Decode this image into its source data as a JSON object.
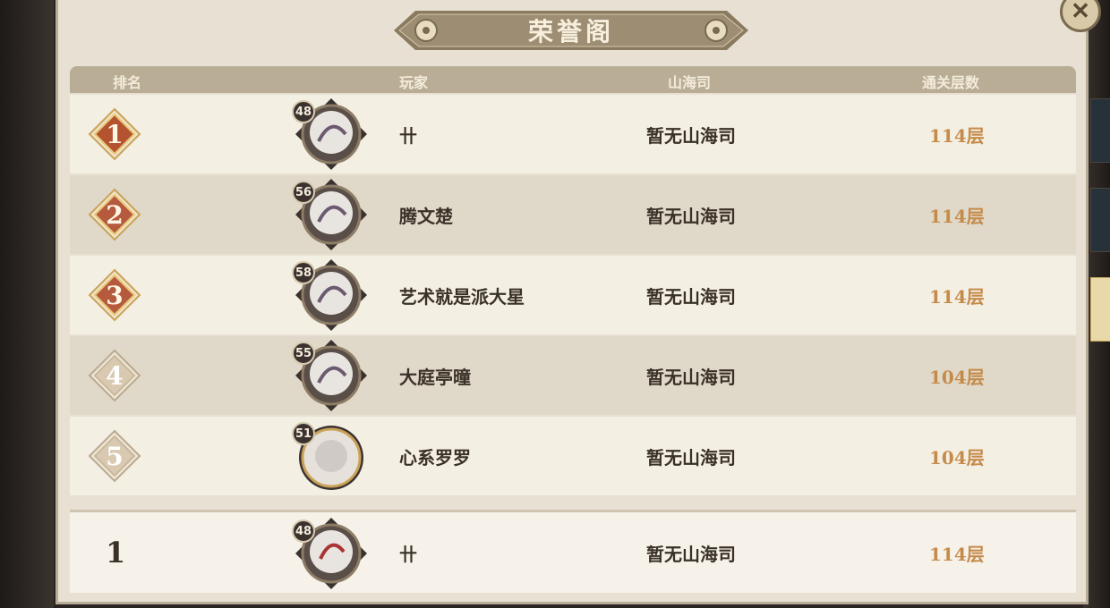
{
  "window": {
    "title": "荣誉阁",
    "close_icon": "close-icon"
  },
  "table": {
    "columns": [
      "排名",
      "玩家",
      "山海司",
      "通关层数"
    ],
    "rows": [
      {
        "rank": "1",
        "level": "48",
        "name": "卄",
        "guild": "暂无山海司",
        "floor": "114层",
        "rank_color": "#b4532f"
      },
      {
        "rank": "2",
        "level": "56",
        "name": "腾文楚",
        "guild": "暂无山海司",
        "floor": "114层",
        "rank_color": "#b65a3e"
      },
      {
        "rank": "3",
        "level": "58",
        "name": "艺术就是派大星",
        "guild": "暂无山海司",
        "floor": "114层",
        "rank_color": "#b65a3e"
      },
      {
        "rank": "4",
        "level": "55",
        "name": "大庭亭曈",
        "guild": "暂无山海司",
        "floor": "104层",
        "rank_color": "#d8c9b0"
      },
      {
        "rank": "5",
        "level": "51",
        "name": "心系罗罗",
        "guild": "暂无山海司",
        "floor": "104层",
        "rank_color": "#d8c9b0"
      }
    ]
  },
  "self": {
    "rank": "1",
    "level": "48",
    "name": "卄",
    "guild": "暂无山海司",
    "floor": "114层"
  },
  "colors": {
    "accent": "#c58b4a",
    "panel": "#e8e1d3",
    "header": "#b9ad95"
  }
}
